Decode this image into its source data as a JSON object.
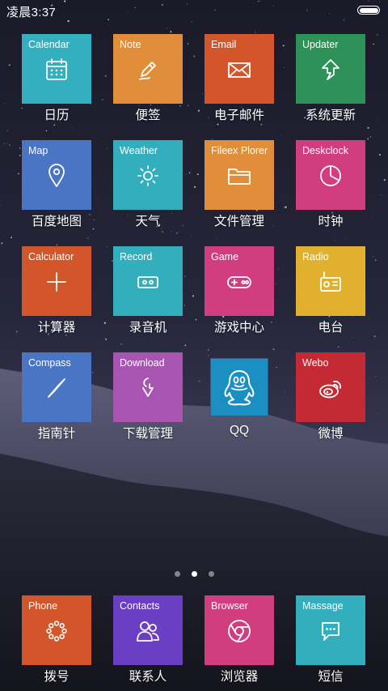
{
  "status_bar": {
    "time": "凌晨3:37",
    "battery_level": 1.0
  },
  "grid": [
    {
      "name": "Calendar",
      "caption": "日历",
      "color": "#33b0c0",
      "icon": "calendar-icon"
    },
    {
      "name": "Note",
      "caption": "便签",
      "color": "#e08e3a",
      "icon": "pencil-icon"
    },
    {
      "name": "Email",
      "caption": "电子邮件",
      "color": "#d2562a",
      "icon": "envelope-icon"
    },
    {
      "name": "Updater",
      "caption": "系统更新",
      "color": "#2e9158",
      "icon": "arrow-up-icon"
    },
    {
      "name": "Map",
      "caption": "百度地图",
      "color": "#4a74c4",
      "icon": "location-pin-icon"
    },
    {
      "name": "Weather",
      "caption": "天气",
      "color": "#33aebd",
      "icon": "sun-icon"
    },
    {
      "name": "Fileex Plorer",
      "caption": "文件管理",
      "color": "#e08e3a",
      "icon": "folder-icon"
    },
    {
      "name": "Deskclock",
      "caption": "时钟",
      "color": "#d13d7e",
      "icon": "clock-icon"
    },
    {
      "name": "Calculator",
      "caption": "计算器",
      "color": "#d2562a",
      "icon": "plus-icon"
    },
    {
      "name": "Record",
      "caption": "录音机",
      "color": "#33aebd",
      "icon": "tape-icon"
    },
    {
      "name": "Game",
      "caption": "游戏中心",
      "color": "#d13d7e",
      "icon": "gamepad-icon"
    },
    {
      "name": "Radio",
      "caption": "电台",
      "color": "#e0b02e",
      "icon": "radio-icon"
    },
    {
      "name": "Compass",
      "caption": "指南针",
      "color": "#4a74c4",
      "icon": "compass-icon"
    },
    {
      "name": "Download",
      "caption": "下载管理",
      "color": "#a755b0",
      "icon": "download-icon"
    },
    {
      "name": "",
      "caption": "QQ",
      "color": "#1b8fc2",
      "icon": "qq-penguin-icon"
    },
    {
      "name": "Webo",
      "caption": "微博",
      "color": "#c42a33",
      "icon": "weibo-icon"
    }
  ],
  "page_indicator": {
    "count": 3,
    "active": 2
  },
  "dock": [
    {
      "name": "Phone",
      "caption": "拨号",
      "color": "#d2562a",
      "icon": "dialpad-icon"
    },
    {
      "name": "Contacts",
      "caption": "联系人",
      "color": "#6a3fc4",
      "icon": "contacts-icon"
    },
    {
      "name": "Browser",
      "caption": "浏览器",
      "color": "#d13d7e",
      "icon": "chrome-icon"
    },
    {
      "name": "Massage",
      "caption": "短信",
      "color": "#33aebd",
      "icon": "message-icon"
    }
  ]
}
